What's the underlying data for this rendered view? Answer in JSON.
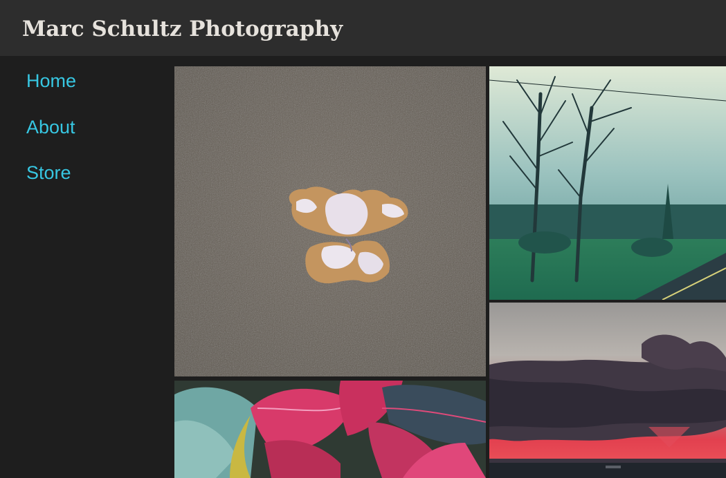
{
  "header": {
    "site_title": "Marc Schultz Photography"
  },
  "nav": {
    "items": [
      {
        "label": "Home"
      },
      {
        "label": "About"
      },
      {
        "label": "Store"
      }
    ]
  },
  "colors": {
    "header_bg": "#2d2d2d",
    "page_bg": "#1e1e1e",
    "title_text": "#e6e2dc",
    "nav_link": "#37c7e2"
  },
  "gallery": {
    "photos": [
      {
        "subject": "shell-on-sand"
      },
      {
        "subject": "bare-trees-landscape"
      },
      {
        "subject": "croton-leaves"
      },
      {
        "subject": "sunset-over-water"
      }
    ]
  }
}
